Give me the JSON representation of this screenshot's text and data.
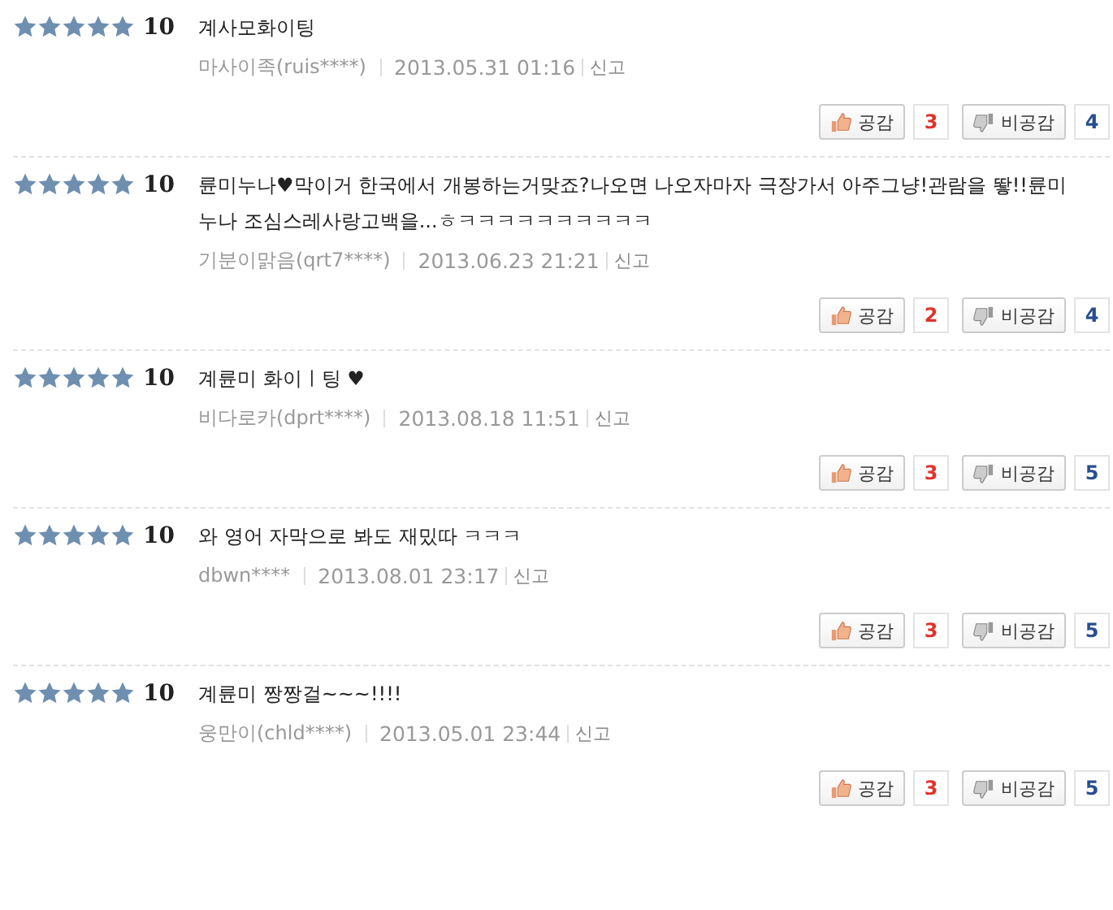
{
  "reviews": [
    {
      "stars": 5,
      "score": "10",
      "text": "계사모화이팅",
      "author": "마사이족(ruis****)",
      "date": "2013.05.31 01:16",
      "report": "신고",
      "like_label": "공감",
      "likes": "3",
      "dislike_label": "비공감",
      "dislikes": "4"
    },
    {
      "stars": 5,
      "score": "10",
      "text": "륜미누나♥막이거 한국에서 개봉하는거맞죠?나오면 나오자마자 극장가서 아주그냥!관람을 뙇!!륜미누나 조심스레사랑고백을...ㅎㅋㅋㅋㅋㅋㅋㅋㅋㅋㅋ",
      "author": "기분이맑음(qrt7****)",
      "date": "2013.06.23 21:21",
      "report": "신고",
      "like_label": "공감",
      "likes": "2",
      "dislike_label": "비공감",
      "dislikes": "4"
    },
    {
      "stars": 5,
      "score": "10",
      "text": "계륜미 화이ㅣ팅 ♥",
      "author": "비다로카(dprt****)",
      "date": "2013.08.18 11:51",
      "report": "신고",
      "like_label": "공감",
      "likes": "3",
      "dislike_label": "비공감",
      "dislikes": "5"
    },
    {
      "stars": 5,
      "score": "10",
      "text": "와 영어 자막으로 봐도 재밌따 ㅋㅋㅋ",
      "author": "dbwn****",
      "date": "2013.08.01 23:17",
      "report": "신고",
      "like_label": "공감",
      "likes": "3",
      "dislike_label": "비공감",
      "dislikes": "5"
    },
    {
      "stars": 5,
      "score": "10",
      "text": "계륜미 짱짱걸~~~!!!!",
      "author": "웅만이(chld****)",
      "date": "2013.05.01 23:44",
      "report": "신고",
      "like_label": "공감",
      "likes": "3",
      "dislike_label": "비공감",
      "dislikes": "5"
    }
  ]
}
